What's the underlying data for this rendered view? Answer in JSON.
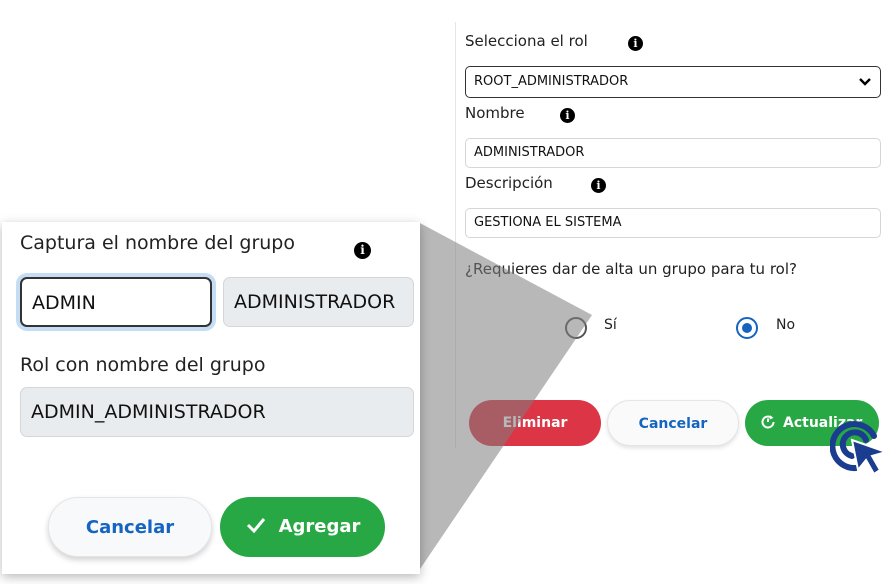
{
  "form": {
    "role_label": "Selecciona el rol",
    "role_value": "ROOT_ADMINISTRADOR",
    "name_label": "Nombre",
    "name_value": "ADMINISTRADOR",
    "desc_label": "Descripción",
    "desc_value": "GESTIONA EL SISTEMA",
    "group_question": "¿Requieres dar de alta un grupo para tu rol?",
    "radio_yes": "Sí",
    "radio_no": "No",
    "selected_radio": "No",
    "buttons": {
      "delete": "Eliminar",
      "cancel": "Cancelar",
      "update": "Actualizar"
    }
  },
  "card": {
    "group_label": "Captura el nombre del grupo",
    "group_input": "ADMIN",
    "group_suffix": "ADMINISTRADOR",
    "role_group_label": "Rol con nombre del grupo",
    "role_group_value": "ADMIN_ADMINISTRADOR",
    "cancel": "Cancelar",
    "add": "Agregar"
  },
  "colors": {
    "primary": "#1565c0",
    "success": "#28a745",
    "danger": "#dc3545"
  },
  "icons": {
    "info": "info-icon",
    "chevron": "chevron-down-icon",
    "refresh": "refresh-icon",
    "check": "check-icon",
    "cursor": "click-cursor-icon"
  }
}
